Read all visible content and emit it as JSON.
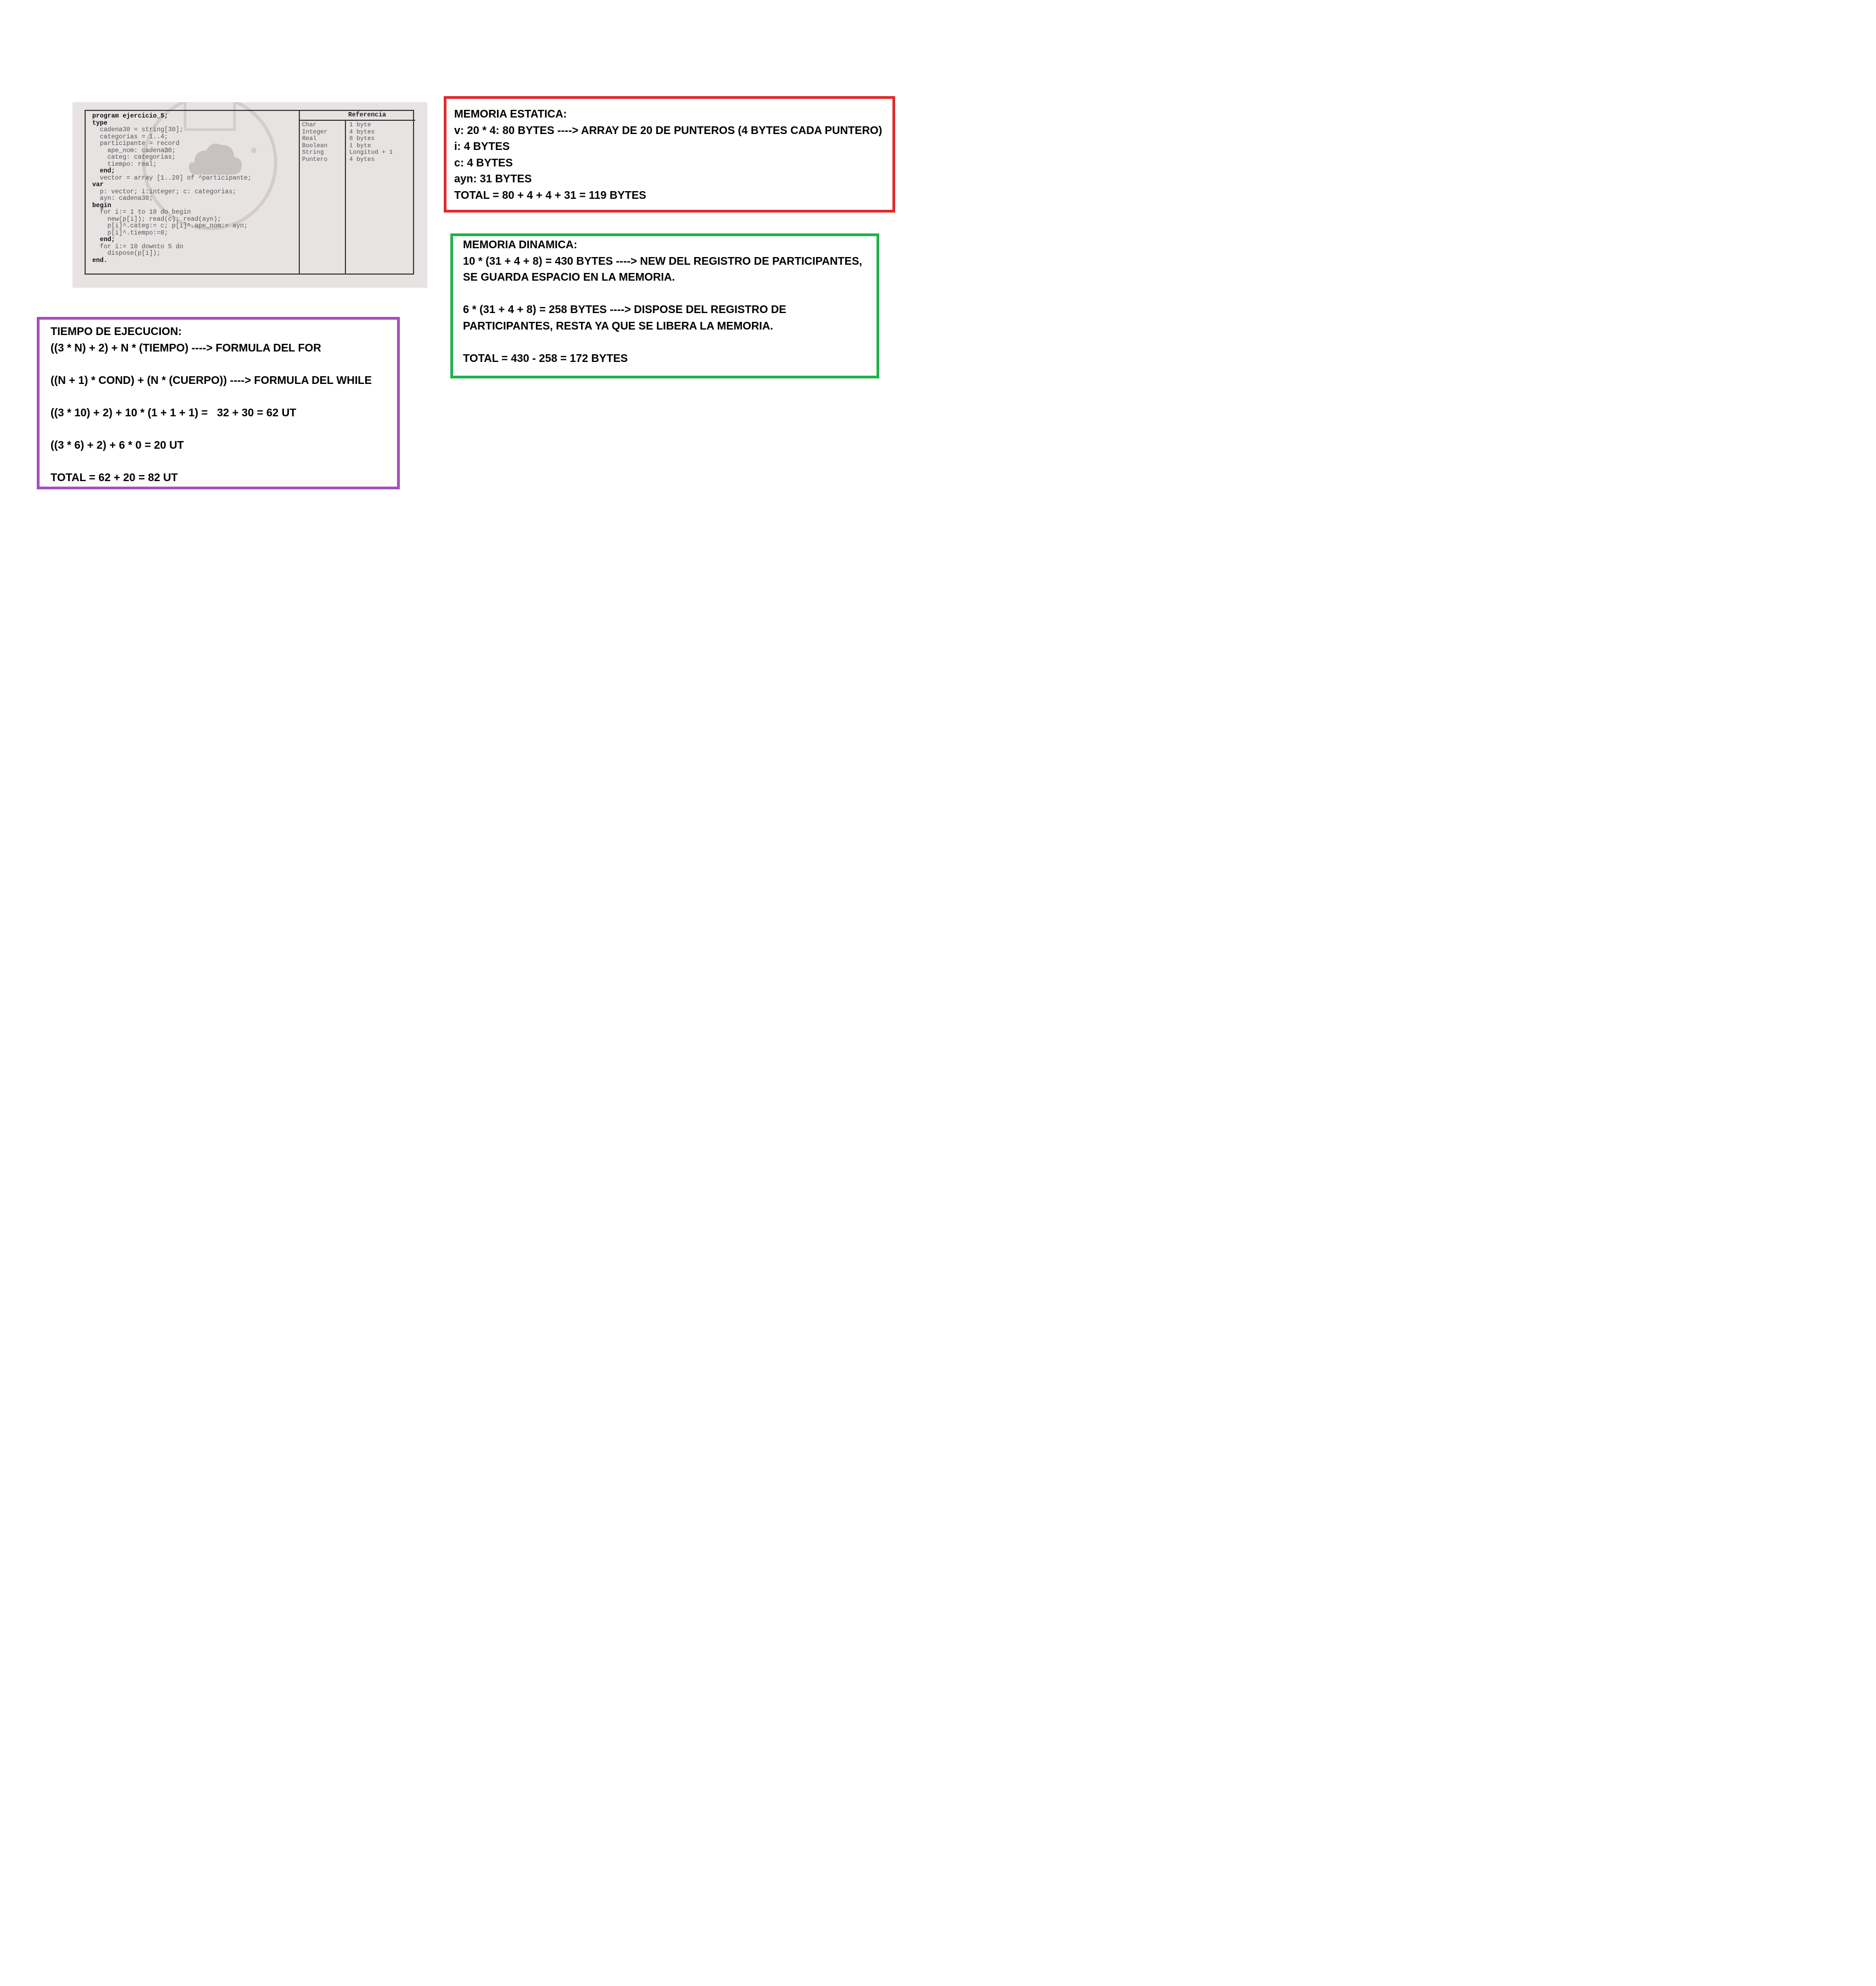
{
  "exercise_photo": {
    "code_lines": [
      "program ejercicio_5;",
      "type",
      "  cadena30 = string[30];",
      "  categorias = 1..4;",
      "  participante = record",
      "    ape_nom: cadena30;",
      "    categ: categorias;",
      "    tiempo: real;",
      "  end;",
      "  vector = array [1..20] of ^participante;",
      "var",
      "  p: vector; i:integer; c: categorias;",
      "  ayn: cadena30;",
      "begin",
      "  for i:= 1 to 10 do begin",
      "    new(p[i]); read(c); read(ayn);",
      "    p[i]^.categ:= c; p[i]^.ape_nom:= ayn;",
      "    p[i]^.tiempo:=0;",
      "  end;",
      "  for i:= 10 downto 5 do",
      "    dispose(p[i]);",
      "end."
    ],
    "reference_table": {
      "header": "Referencia",
      "types": [
        "Char",
        "Integer",
        "Real",
        "Boolean",
        "String",
        "Puntero"
      ],
      "sizes": [
        "1 byte",
        "4 bytes",
        "8 bytes",
        "1 byte",
        "Longitud + 1",
        "4 bytes"
      ]
    }
  },
  "memoria_estatica": {
    "color": "#e02b2f",
    "lines": [
      "MEMORIA ESTATICA:",
      "v: 20 * 4: 80 BYTES ----> ARRAY DE 20 DE PUNTEROS (4 BYTES CADA PUNTERO)",
      "i: 4 BYTES",
      "c: 4 BYTES",
      "ayn: 31 BYTES",
      "TOTAL = 80 + 4 + 4 + 31 = 119 BYTES"
    ]
  },
  "memoria_dinamica": {
    "color": "#22b14c",
    "title": "MEMORIA DINAMICA:",
    "new_line_1": "10 * (31 + 4 + 8) = 430 BYTES ----> NEW DEL REGISTRO DE PARTICIPANTES,",
    "new_line_2": "SE GUARDA ESPACIO EN LA MEMORIA.",
    "dispose_line_1": "6 * (31 + 4 + 8) = 258 BYTES ----> DISPOSE DEL REGISTRO DE",
    "dispose_line_2": "PARTICIPANTES, RESTA YA QUE SE LIBERA LA MEMORIA.",
    "total": "TOTAL = 430 - 258 = 172 BYTES"
  },
  "tiempo_ejecucion": {
    "color": "#a64ec0",
    "title": "TIEMPO DE EJECUCION:",
    "formula_for": "((3 * N) + 2) + N * (TIEMPO) ----> FORMULA DEL FOR",
    "formula_while": "((N + 1) * COND) + (N * (CUERPO)) ----> FORMULA DEL WHILE",
    "calc_1": "((3 * 10) + 2) + 10 * (1 + 1 + 1) =   32 + 30 = 62 UT",
    "calc_2": "((3 * 6) + 2) + 6 * 0 = 20 UT",
    "total": "TOTAL = 62 + 20 = 82 UT"
  }
}
